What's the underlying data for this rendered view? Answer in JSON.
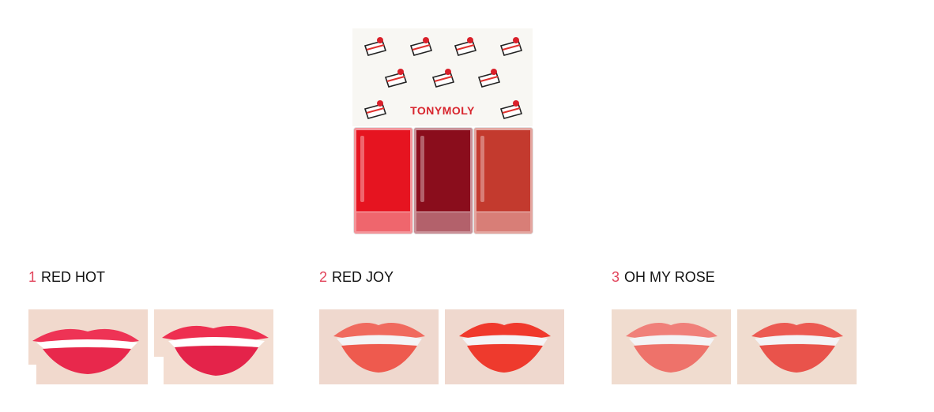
{
  "product": {
    "brand": "TONYMOLY",
    "icons": [
      "cake-slice-icon"
    ],
    "bottle_colors": [
      "#e61420",
      "#8a0d1c",
      "#c33a2e"
    ],
    "cap_color": "#f8f7f3",
    "brand_color": "#d8262e"
  },
  "shades": [
    {
      "number": "1",
      "name": "RED HOT",
      "number_color": "#e2455c",
      "skin": "#f1d9cd",
      "lip_color": "#ee3355",
      "swatches": [
        "lip-swatch-smile",
        "lip-swatch-open"
      ]
    },
    {
      "number": "2",
      "name": "RED JOY",
      "number_color": "#e2455c",
      "skin": "#efd8ce",
      "lip_color": "#f0392c",
      "swatches": [
        "lip-swatch-light",
        "lip-swatch-full"
      ]
    },
    {
      "number": "3",
      "name": "OH MY ROSE",
      "number_color": "#e2455c",
      "skin": "#f0dccf",
      "lip_color": "#ec5a52",
      "swatches": [
        "lip-swatch-light",
        "lip-swatch-full"
      ]
    }
  ]
}
